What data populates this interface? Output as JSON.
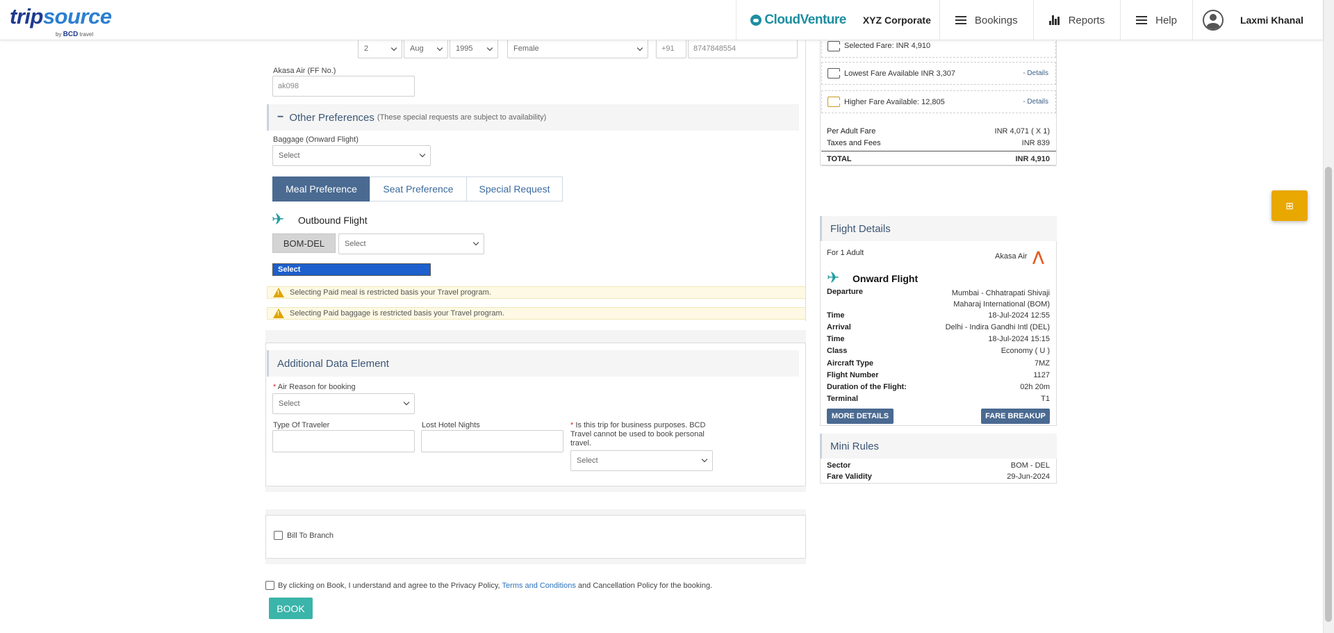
{
  "header": {
    "logo_trip": "trip",
    "logo_source": "source",
    "logo_by": "by",
    "logo_bcd": "BCD",
    "logo_travel": "travel",
    "cloud_venture": "CloudVenture",
    "corporate": "XYZ Corporate",
    "nav": {
      "bookings": "Bookings",
      "reports": "Reports",
      "help": "Help"
    },
    "user_name": "Laxmi Khanal"
  },
  "traveler": {
    "dob_day": "2",
    "dob_month": "Aug",
    "dob_year": "1995",
    "gender": "Female",
    "phone_code": "+91",
    "phone": "8747848554",
    "ff_label": "Akasa Air (FF No.)",
    "ff_value": "ak098"
  },
  "preferences": {
    "title": "Other Preferences",
    "note": "(These special requests are subject to availability)",
    "baggage_label": "Baggage (Onward Flight)",
    "baggage_value": "Select",
    "tabs": [
      "Meal Preference",
      "Seat Preference",
      "Special Request"
    ],
    "outbound_label": "Outbound Flight",
    "sector": "BOM-DEL",
    "meal_value": "Select",
    "highlighted_option": "Select",
    "warning_meal": "Selecting Paid meal is restricted basis your Travel program.",
    "warning_baggage": "Selecting Paid baggage is restricted basis your Travel program."
  },
  "additional": {
    "title": "Additional Data Element",
    "air_reason_label": "Air Reason for booking",
    "air_reason_value": "Select",
    "type_traveler_label": "Type Of Traveler",
    "lost_hotel_label": "Lost Hotel Nights",
    "business_label": "Is this trip for business purposes. BCD Travel cannot be used to book personal travel.",
    "business_value": "Select"
  },
  "billing": {
    "bill_to_branch": "Bill To Branch"
  },
  "agreement": {
    "pre": "By clicking on Book, I understand and agree to the Privacy Policy,",
    "link": "Terms and Conditions",
    "post": "and Cancellation Policy for the booking."
  },
  "book_label": "BOOK",
  "fare": {
    "selected": "Selected Fare: INR 4,910",
    "lowest": "Lowest Fare Available INR 3,307",
    "higher": "Higher Fare Available: 12,805",
    "details": "- Details",
    "per_adult_label": "Per Adult Fare",
    "per_adult_value": "INR 4,071 ( X 1)",
    "taxes_label": "Taxes and Fees",
    "taxes_value": "INR 839",
    "total_label": "TOTAL",
    "total_value": "INR 4,910"
  },
  "flight": {
    "title": "Flight Details",
    "for_adults": "For 1 Adult",
    "airline": "Akasa Air",
    "onward": "Onward Flight",
    "rows": [
      {
        "k": "Departure",
        "v": "Mumbai - Chhatrapati Shivaji Maharaj International (BOM)"
      },
      {
        "k": "Time",
        "v": "18-Jul-2024 12:55"
      },
      {
        "k": "Arrival",
        "v": "Delhi - Indira Gandhi Intl (DEL)"
      },
      {
        "k": "Time",
        "v": "18-Jul-2024 15:15"
      },
      {
        "k": "Class",
        "v": "Economy ( U )"
      },
      {
        "k": "Aircraft Type",
        "v": "7MZ"
      },
      {
        "k": "Flight Number",
        "v": "1127"
      },
      {
        "k": "Duration of the Flight:",
        "v": "02h 20m"
      },
      {
        "k": "Terminal",
        "v": "T1"
      }
    ],
    "more_details": "MORE DETAILS",
    "fare_breakup": "FARE BREAKUP"
  },
  "mini_rules": {
    "title": "Mini Rules",
    "sector_label": "Sector",
    "sector_value": "BOM - DEL",
    "validity_label": "Fare Validity",
    "validity_value": "29-Jun-2024"
  },
  "float_icon": "grid-icon"
}
